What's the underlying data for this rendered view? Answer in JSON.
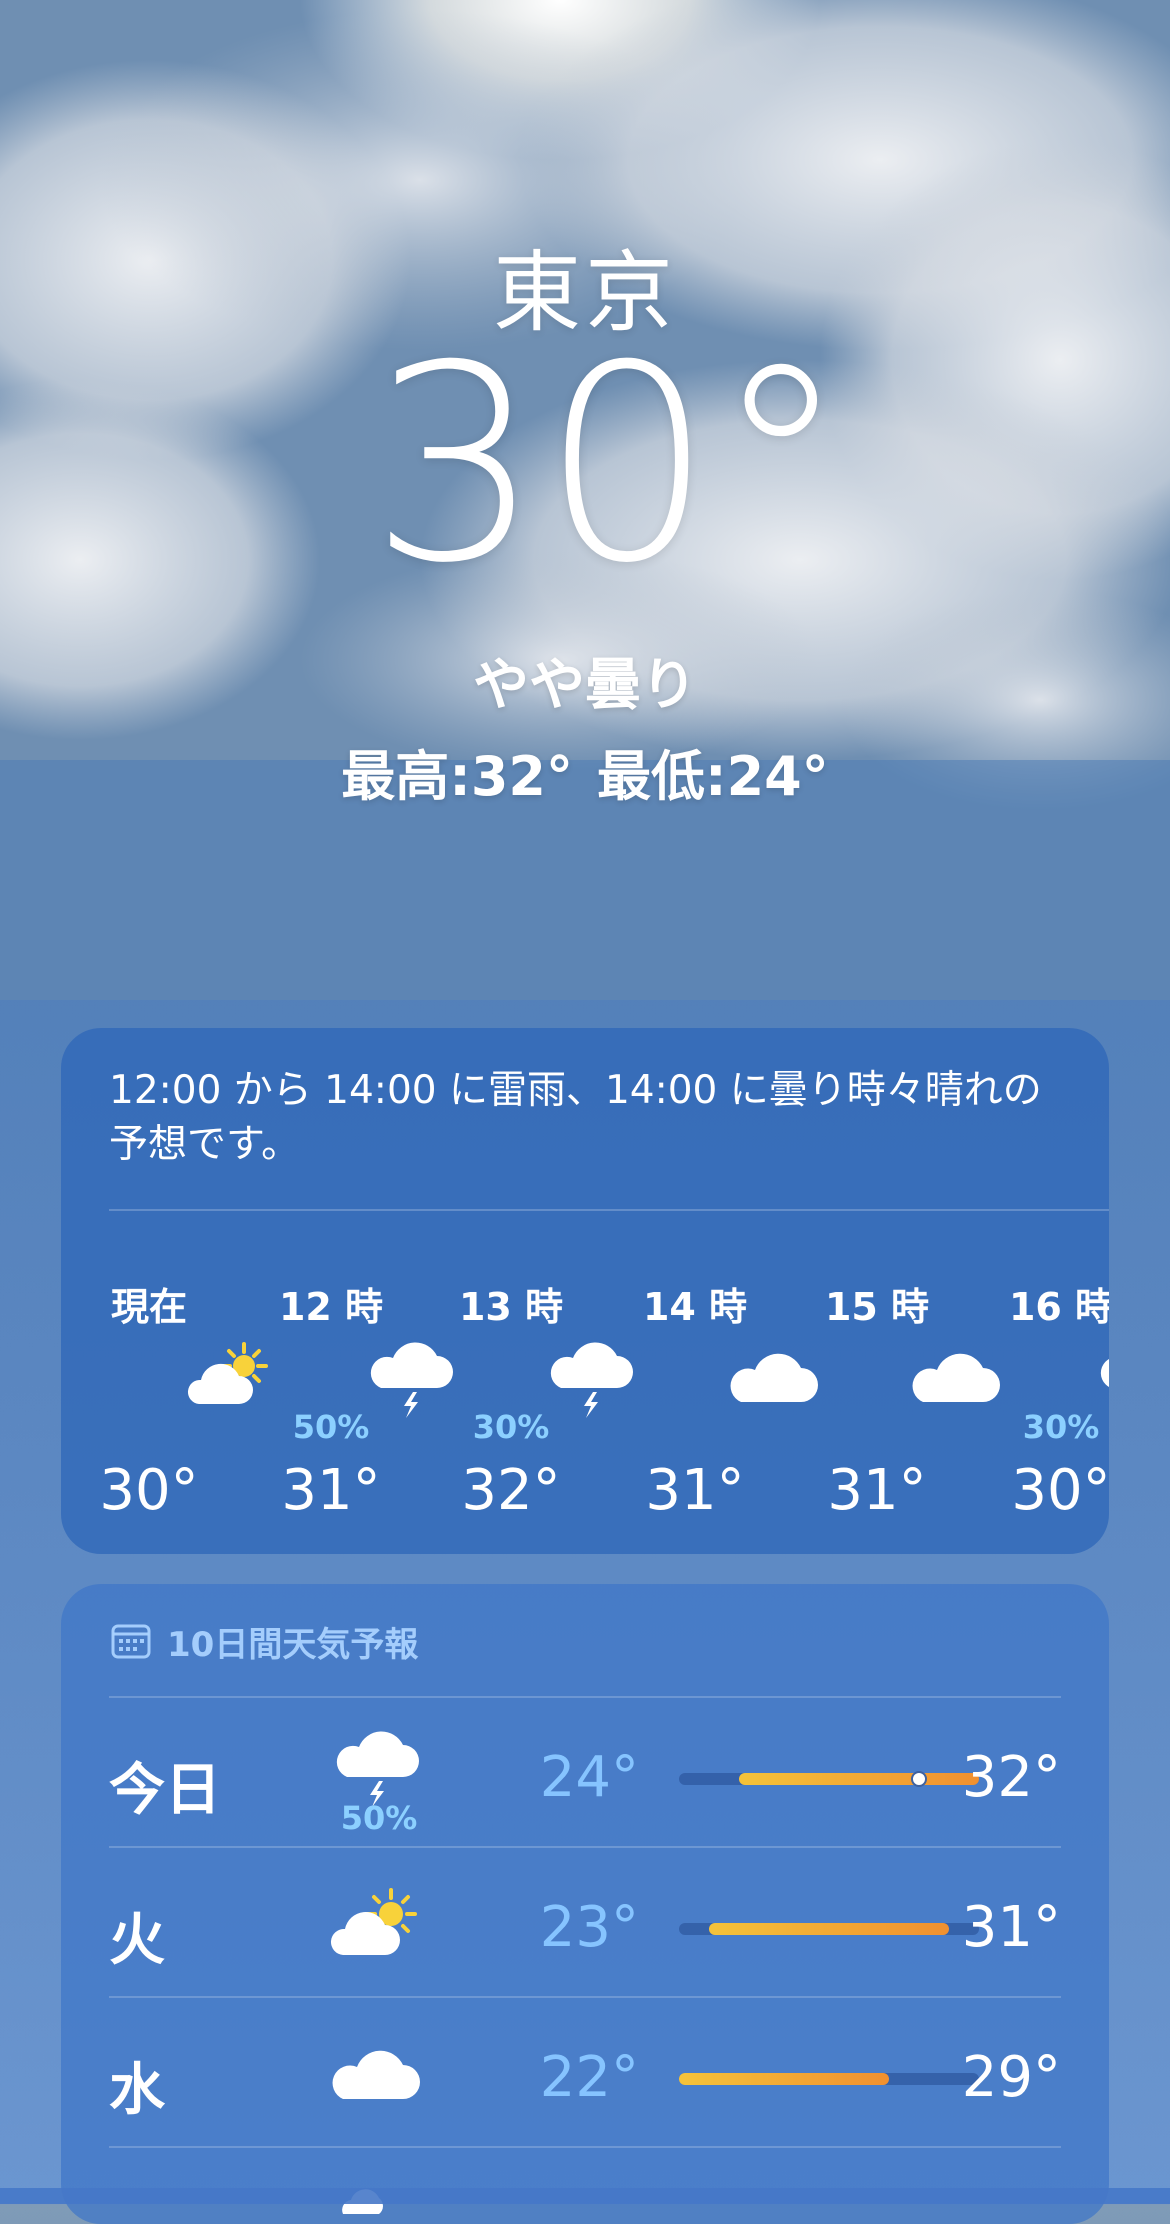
{
  "location": {
    "city": "東京"
  },
  "current": {
    "temp": "30°",
    "condition": "やや曇り",
    "high": "最高:32°",
    "low": "最低:24°"
  },
  "hourly": {
    "summary": "12:00 から 14:00 に雷雨、14:00 に曇り時々晴れの予想です。",
    "items": [
      {
        "label": "現在",
        "icon": "partly-sunny-icon",
        "precip": "",
        "temp": "30°"
      },
      {
        "label": "12 時",
        "icon": "thunderstorm-icon",
        "precip": "50%",
        "temp": "31°"
      },
      {
        "label": "13 時",
        "icon": "thunderstorm-icon",
        "precip": "30%",
        "temp": "32°"
      },
      {
        "label": "14 時",
        "icon": "cloud-icon",
        "precip": "",
        "temp": "31°"
      },
      {
        "label": "15 時",
        "icon": "cloud-icon",
        "precip": "",
        "temp": "31°"
      },
      {
        "label": "16 時",
        "icon": "thunderstorm-icon",
        "precip": "30%",
        "temp": "30°"
      }
    ]
  },
  "forecast": {
    "title": "10日間天気予報",
    "days": [
      {
        "day": "今日",
        "icon": "thunderstorm-icon",
        "precip": "50%",
        "low": "24°",
        "high": "32°",
        "current_temp": 30
      },
      {
        "day": "火",
        "icon": "partly-sunny-icon",
        "precip": "",
        "low": "23°",
        "high": "31°"
      },
      {
        "day": "水",
        "icon": "cloud-icon",
        "precip": "",
        "low": "22°",
        "high": "29°"
      }
    ],
    "bar_range": [
      22,
      32
    ]
  },
  "colors": {
    "accent_precip": "#8cd0ff",
    "low_temp": "#86c4ff",
    "bar_start": "#f5c33a",
    "bar_end": "#f09030"
  }
}
